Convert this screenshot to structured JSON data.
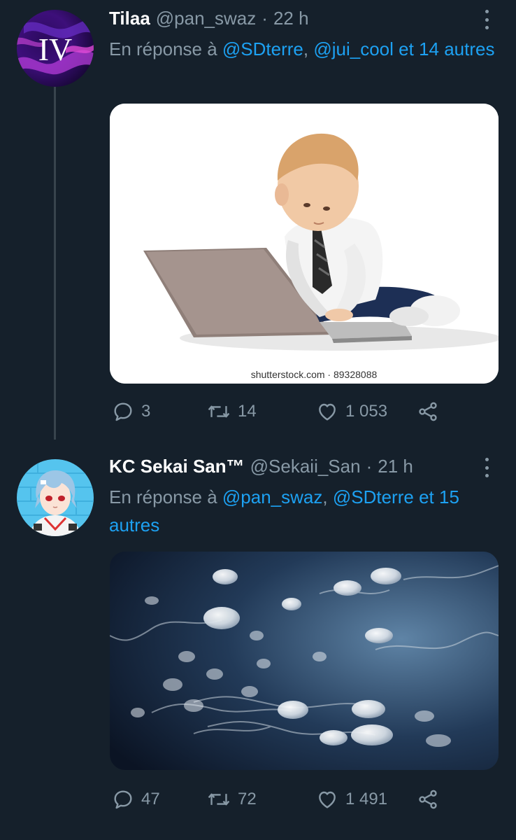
{
  "tweets": [
    {
      "display_name": "Tilaa",
      "handle": "@pan_swaz",
      "dot": "·",
      "time": "22 h",
      "reply_prefix": "En réponse à",
      "reply_mentions": [
        "@SDterre",
        "@jui_cool"
      ],
      "reply_sep": ",",
      "reply_and": "et",
      "reply_others": "14 autres",
      "avatar_text": "IV",
      "media_watermark": "shutterstock.com · 89328088",
      "stats": {
        "replies": "3",
        "retweets": "14",
        "likes": "1 053"
      }
    },
    {
      "display_name": "KC Sekai San™",
      "handle": "@Sekaii_San",
      "dot": "·",
      "time": "21 h",
      "reply_prefix": "En réponse à",
      "reply_mentions": [
        "@pan_swaz",
        "@SDterre"
      ],
      "reply_sep": ",",
      "reply_and": "et",
      "reply_others": "15 autres",
      "stats": {
        "replies": "47",
        "retweets": "72",
        "likes": "1 491"
      }
    }
  ],
  "icons": {
    "reply": "reply-icon",
    "retweet": "retweet-icon",
    "like": "heart-icon",
    "share": "share-icon",
    "more": "more-options-icon"
  },
  "colors": {
    "background": "#15202b",
    "secondary_text": "#8899a6",
    "link": "#1da1f2",
    "thread_line": "#38444d"
  }
}
